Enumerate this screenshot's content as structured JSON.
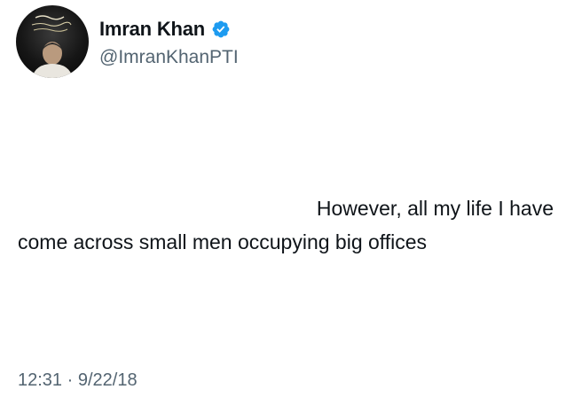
{
  "author": {
    "display_name": "Imran Khan",
    "handle": "@ImranKhanPTI",
    "verified_icon": "verified-badge-icon",
    "verified_color": "#1d9bf0"
  },
  "tweet": {
    "lines": [
      "However, all my life I have",
      "come across small men occupying big offices"
    ]
  },
  "meta": {
    "time": "12:31",
    "separator": "·",
    "date": "9/22/18"
  }
}
